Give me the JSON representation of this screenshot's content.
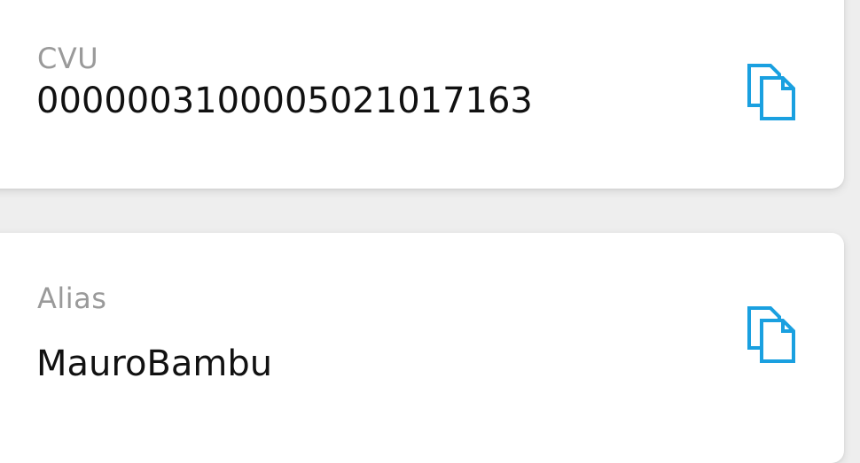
{
  "colors": {
    "accent": "#1aa0e0",
    "background": "#eeeeee",
    "card": "#ffffff",
    "label": "#9a9a9a",
    "value": "#111111"
  },
  "cards": [
    {
      "label": "CVU",
      "value": "0000003100005021017163",
      "action_icon": "copy-icon"
    },
    {
      "label": "Alias",
      "value": "MauroBambu",
      "action_icon": "copy-icon"
    }
  ]
}
